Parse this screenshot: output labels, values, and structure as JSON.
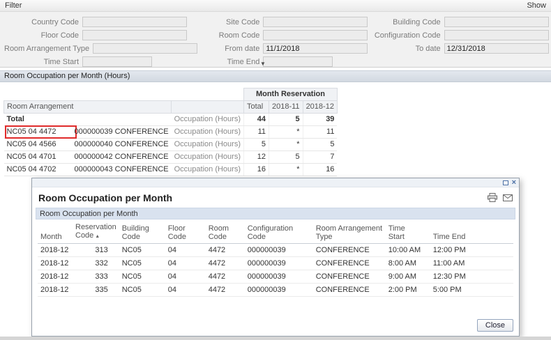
{
  "colors": {
    "panel_header": "#d9dfe7",
    "dialog_band": "#d9e2ef",
    "annotation_red": "#e02b2b"
  },
  "filter": {
    "title": "Filter",
    "show_button": "Show",
    "collapse_icon": "▼",
    "fields": [
      {
        "label": "Country Code",
        "value": ""
      },
      {
        "label": "Site Code",
        "value": ""
      },
      {
        "label": "Building Code",
        "value": ""
      },
      {
        "label": "Floor Code",
        "value": ""
      },
      {
        "label": "Room Code",
        "value": ""
      },
      {
        "label": "Configuration Code",
        "value": ""
      },
      {
        "label": "Room Arrangement Type",
        "value": ""
      },
      {
        "label": "From date",
        "value": "11/1/2018"
      },
      {
        "label": "To date",
        "value": "12/31/2018"
      },
      {
        "label": "Time Start",
        "value": ""
      },
      {
        "label": "Time End",
        "value": ""
      }
    ]
  },
  "pivot": {
    "title": "Room Occupation per Month (Hours)",
    "group_header": "Month Reservation",
    "row_header": "Room Arrangement",
    "columns": {
      "total": "Total",
      "m1": "2018-11",
      "m2": "2018-12"
    },
    "rows": [
      {
        "code": "Total",
        "suffix": "",
        "measure": "Occupation (Hours)",
        "total": "44",
        "m1": "5",
        "m2": "39",
        "is_total": true
      },
      {
        "code": "NC05 04 4472",
        "suffix": "000000039 CONFERENCE",
        "measure": "Occupation (Hours)",
        "total": "11",
        "m1": "*",
        "m2": "11",
        "highlight": true
      },
      {
        "code": "NC05 04 4566",
        "suffix": "000000040 CONFERENCE",
        "measure": "Occupation (Hours)",
        "total": "5",
        "m1": "*",
        "m2": "5"
      },
      {
        "code": "NC05 04 4701",
        "suffix": "000000042 CONFERENCE",
        "measure": "Occupation (Hours)",
        "total": "12",
        "m1": "5",
        "m2": "7"
      },
      {
        "code": "NC05 04 4702",
        "suffix": "000000043 CONFERENCE",
        "measure": "Occupation (Hours)",
        "total": "16",
        "m1": "*",
        "m2": "16"
      }
    ]
  },
  "dialog": {
    "window_title": "Room Occupation per Month",
    "subheader": "Room Occupation per Month",
    "close_button": "Close",
    "sort_indicator": "▲",
    "window_controls": {
      "close": "×"
    },
    "columns": [
      "Month",
      "Reservation\nCode",
      "Building\nCode",
      "Floor\nCode",
      "Room\nCode",
      "Configuration\nCode",
      "Room Arrangement\nType",
      "Time\nStart",
      "Time End"
    ],
    "rows": [
      {
        "month": "2018-12",
        "reservation_code": "313",
        "building": "NC05",
        "floor": "04",
        "room": "4472",
        "config": "000000039",
        "arrangement_type": "CONFERENCE",
        "time_start": "10:00 AM",
        "time_end": "12:00 PM"
      },
      {
        "month": "2018-12",
        "reservation_code": "332",
        "building": "NC05",
        "floor": "04",
        "room": "4472",
        "config": "000000039",
        "arrangement_type": "CONFERENCE",
        "time_start": "8:00 AM",
        "time_end": "11:00 AM"
      },
      {
        "month": "2018-12",
        "reservation_code": "333",
        "building": "NC05",
        "floor": "04",
        "room": "4472",
        "config": "000000039",
        "arrangement_type": "CONFERENCE",
        "time_start": "9:00 AM",
        "time_end": "12:30 PM"
      },
      {
        "month": "2018-12",
        "reservation_code": "335",
        "building": "NC05",
        "floor": "04",
        "room": "4472",
        "config": "000000039",
        "arrangement_type": "CONFERENCE",
        "time_start": "2:00 PM",
        "time_end": "5:00 PM"
      }
    ]
  }
}
